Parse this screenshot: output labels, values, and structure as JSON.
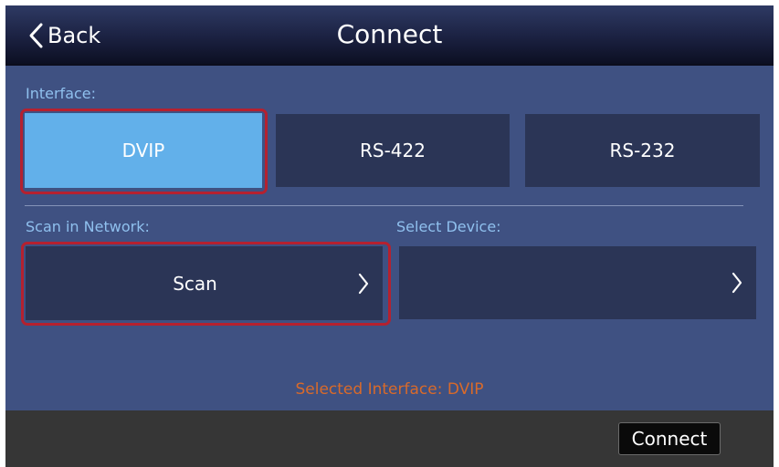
{
  "header": {
    "back_label": "Back",
    "title": "Connect"
  },
  "interface": {
    "label": "Interface:",
    "options": [
      "DVIP",
      "RS-422",
      "RS-232"
    ],
    "selected": "DVIP"
  },
  "scan": {
    "label": "Scan in Network:",
    "button_label": "Scan"
  },
  "device": {
    "label": "Select Device:",
    "value": ""
  },
  "status": {
    "text": "Selected Interface: DVIP"
  },
  "footer": {
    "connect_label": "Connect"
  },
  "colors": {
    "panel": "#3f5182",
    "tile": "#2b3556",
    "selected_tile": "#62b0ea",
    "highlight": "#b5212f",
    "label": "#8fc0ee",
    "status": "#d96a2a"
  }
}
